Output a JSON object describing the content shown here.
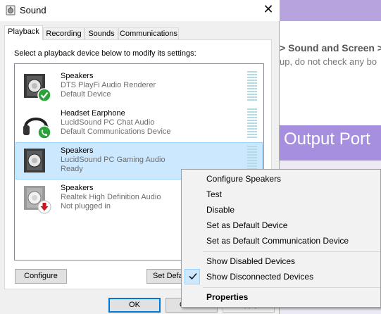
{
  "dialog": {
    "title": "Sound",
    "tabs": [
      {
        "label": "Playback"
      },
      {
        "label": "Recording"
      },
      {
        "label": "Sounds"
      },
      {
        "label": "Communications"
      }
    ],
    "instruction": "Select a playback device below to modify its settings:",
    "devices": [
      {
        "name": "Speakers",
        "driver": "DTS PlayFi Audio Renderer",
        "status": "Default Device",
        "icon": "speaker-default-icon"
      },
      {
        "name": "Headset Earphone",
        "driver": "LucidSound PC Chat Audio",
        "status": "Default Communications Device",
        "icon": "headset-communications-icon"
      },
      {
        "name": "Speakers",
        "driver": "LucidSound PC Gaming Audio",
        "status": "Ready",
        "icon": "speaker-icon"
      },
      {
        "name": "Speakers",
        "driver": "Realtek High Definition Audio",
        "status": "Not plugged in",
        "icon": "speaker-unplugged-icon"
      }
    ],
    "buttons": {
      "configure": "Configure",
      "set_default": "Set Defa",
      "ok": "OK",
      "cancel": "Cancel",
      "apply": "Apply"
    }
  },
  "context_menu": {
    "items": [
      {
        "label": "Configure Speakers"
      },
      {
        "label": "Test"
      },
      {
        "label": "Disable"
      },
      {
        "label": "Set as Default Device"
      },
      {
        "label": "Set as Default Communication Device"
      },
      {
        "label": "Show Disabled Devices"
      },
      {
        "label": "Show Disconnected Devices",
        "checked": true
      },
      {
        "label": "Properties",
        "bold": true
      }
    ]
  },
  "background": {
    "nav": "> Sound and Screen > A",
    "note": "up, do not check any bo",
    "banner": "Output Port"
  },
  "colors": {
    "selection": "#cce8ff",
    "selection_border": "#99d1ff",
    "status_green": "#2aa33a",
    "unplugged_red": "#c8171e",
    "banner_purple": "#a78fe0"
  }
}
